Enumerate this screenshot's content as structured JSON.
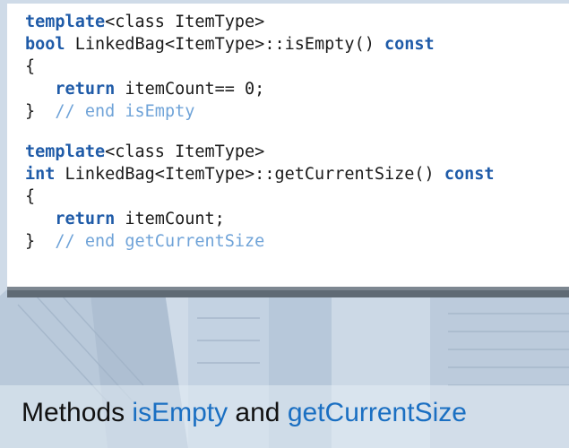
{
  "code_block": {
    "function1": {
      "template_keyword": "template",
      "template_params": "<class ItemType>",
      "return_type": "bool",
      "signature": " LinkedBag<ItemType>::isEmpty() ",
      "const_keyword": "const",
      "open_brace": "{",
      "body_indent": "   ",
      "return_keyword": "return",
      "return_expr": " itemCount== 0;",
      "close_brace": "}",
      "end_comment": "// end isEmpty"
    },
    "function2": {
      "template_keyword": "template",
      "template_params": "<class ItemType>",
      "return_type": "int",
      "signature": " LinkedBag<ItemType>::getCurrentSize() ",
      "const_keyword": "const",
      "open_brace": "{",
      "body_indent": "   ",
      "return_keyword": "return",
      "return_expr": " itemCount;",
      "close_brace": "}",
      "end_comment": "// end getCurrentSize"
    }
  },
  "caption": {
    "prefix": "Methods ",
    "method1": "isEmpty",
    "middle": " and ",
    "method2": "getCurrentSize"
  },
  "colors": {
    "keyword": "#1f5ba8",
    "comment": "#6fa3d8",
    "caption_highlight": "#1a6fc2"
  }
}
